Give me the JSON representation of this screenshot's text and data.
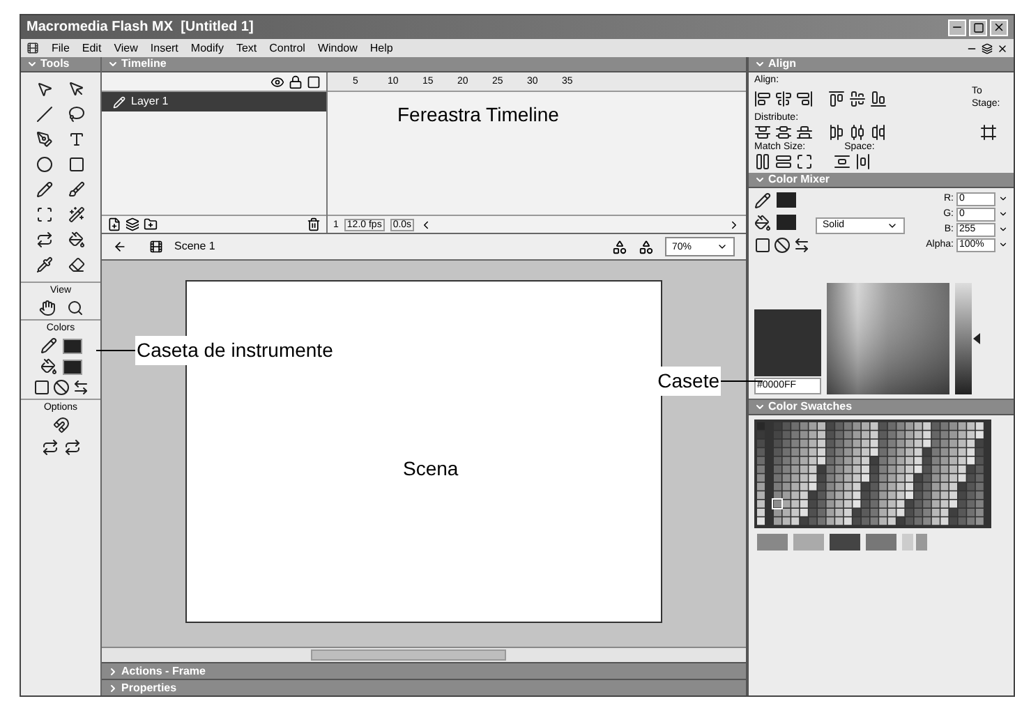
{
  "window": {
    "title": "Macromedia Flash MX  [Untitled 1]"
  },
  "menu": [
    "File",
    "Edit",
    "View",
    "Insert",
    "Modify",
    "Text",
    "Control",
    "Window",
    "Help"
  ],
  "tools_panel": {
    "title": "Tools",
    "sections": [
      "View",
      "Colors",
      "Options"
    ]
  },
  "timeline": {
    "title": "Timeline",
    "layers": [
      {
        "name": "Layer 1",
        "selected": true
      }
    ],
    "frame_numbers": [
      "5",
      "10",
      "15",
      "20",
      "25",
      "30",
      "35"
    ],
    "current_frame": "1",
    "frame_rate": "12.0 fps",
    "elapsed": "0.0s"
  },
  "edit_bar": {
    "scene": "Scene 1",
    "zoom": "70%"
  },
  "bottom_panels": [
    "Actions - Frame",
    "Properties"
  ],
  "align_panel": {
    "title": "Align",
    "align_label": "Align:",
    "distribute_label": "Distribute:",
    "match_size_label": "Match Size:",
    "space_label": "Space:",
    "to_stage_label": "To Stage:"
  },
  "color_mixer": {
    "title": "Color Mixer",
    "fill_style": "Solid",
    "channels": [
      {
        "label": "R:",
        "value": "0"
      },
      {
        "label": "G:",
        "value": "0"
      },
      {
        "label": "B:",
        "value": "255"
      },
      {
        "label": "Alpha:",
        "value": "100%"
      }
    ],
    "hex": "#0000FF"
  },
  "color_swatches": {
    "title": "Color Swatches"
  },
  "annotations": [
    {
      "kind": "timeline",
      "text": "Fereastra Timeline"
    },
    {
      "kind": "tools",
      "text": "Caseta de instrumente"
    },
    {
      "kind": "panels",
      "text": "Casete"
    },
    {
      "kind": "stage",
      "text": "Scena"
    }
  ]
}
